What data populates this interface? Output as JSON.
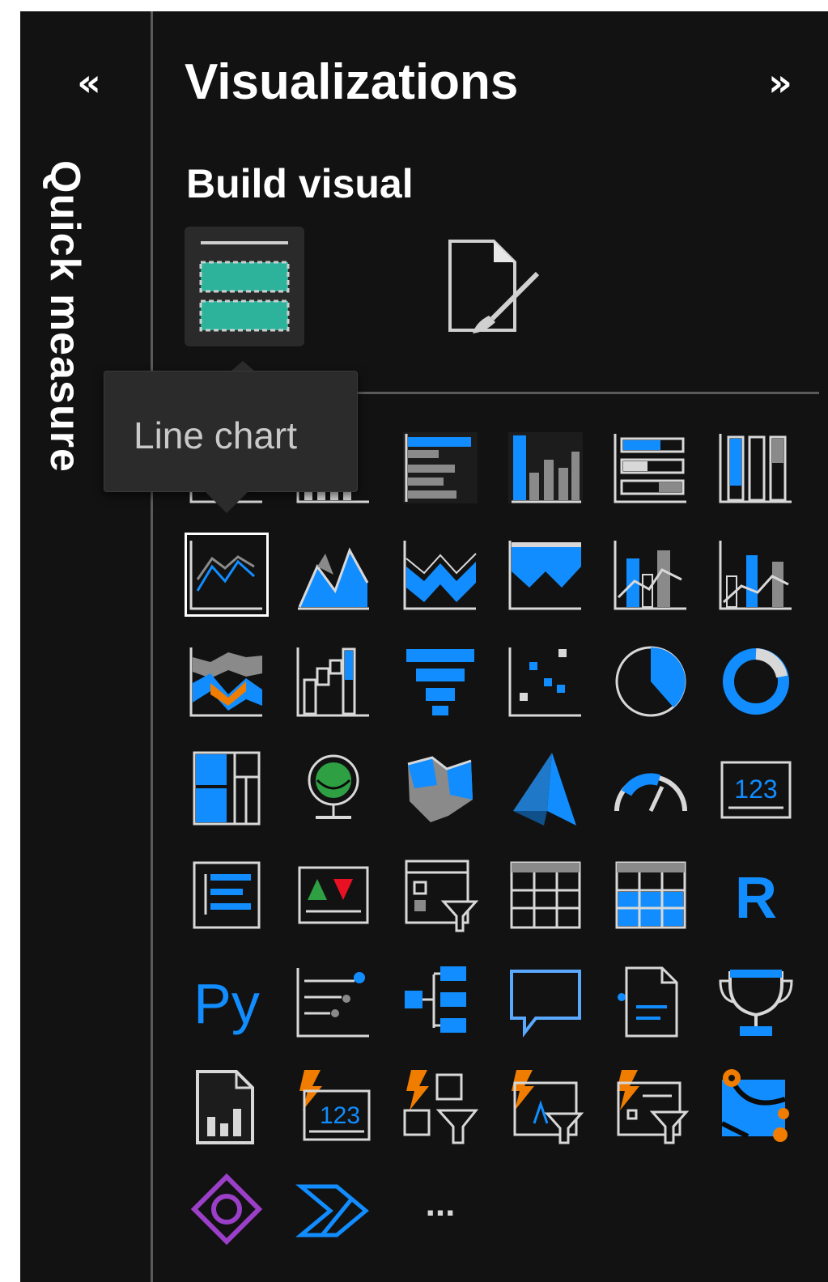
{
  "pane": {
    "title": "Visualizations",
    "collapse_glyph": "«",
    "expand_glyph": "»",
    "rail_label": "Quick measure",
    "build_label": "Build visual",
    "build_buttons": [
      {
        "name": "fields-icon"
      },
      {
        "name": "format-visual-icon"
      }
    ],
    "tooltip": "Line chart",
    "more_label": "...",
    "colors": {
      "background": "#121212",
      "blue": "#118dff",
      "teal": "#2db39b",
      "orange": "#f07d00",
      "purple": "#9b3fc8",
      "green": "#2ea043",
      "red": "#e81123"
    }
  },
  "visuals": [
    {
      "name": "stacked-bar-chart-icon"
    },
    {
      "name": "stacked-column-chart-icon"
    },
    {
      "name": "clustered-bar-chart-icon"
    },
    {
      "name": "clustered-column-chart-icon"
    },
    {
      "name": "100-stacked-bar-chart-icon"
    },
    {
      "name": "100-stacked-column-chart-icon"
    },
    {
      "name": "line-chart-icon"
    },
    {
      "name": "area-chart-icon"
    },
    {
      "name": "stacked-area-chart-icon"
    },
    {
      "name": "100-stacked-area-chart-icon"
    },
    {
      "name": "line-and-stacked-column-chart-icon"
    },
    {
      "name": "line-and-clustered-column-chart-icon"
    },
    {
      "name": "ribbon-chart-icon"
    },
    {
      "name": "waterfall-chart-icon"
    },
    {
      "name": "funnel-icon"
    },
    {
      "name": "scatter-chart-icon"
    },
    {
      "name": "pie-chart-icon"
    },
    {
      "name": "donut-chart-icon"
    },
    {
      "name": "treemap-icon"
    },
    {
      "name": "map-icon"
    },
    {
      "name": "filled-map-icon"
    },
    {
      "name": "azure-map-icon"
    },
    {
      "name": "gauge-icon"
    },
    {
      "name": "card-icon"
    },
    {
      "name": "multi-row-card-icon"
    },
    {
      "name": "kpi-icon"
    },
    {
      "name": "slicer-icon"
    },
    {
      "name": "table-icon"
    },
    {
      "name": "matrix-icon"
    },
    {
      "name": "r-script-visual-icon"
    },
    {
      "name": "python-visual-icon"
    },
    {
      "name": "key-influencers-icon"
    },
    {
      "name": "decomposition-tree-icon"
    },
    {
      "name": "qa-icon"
    },
    {
      "name": "smart-narrative-icon"
    },
    {
      "name": "metrics-icon"
    },
    {
      "name": "paginated-report-icon"
    },
    {
      "name": "card-new-icon"
    },
    {
      "name": "slicer-new-icon"
    },
    {
      "name": "button-slicer-icon"
    },
    {
      "name": "list-slicer-icon"
    },
    {
      "name": "arcgis-map-icon"
    },
    {
      "name": "power-apps-icon"
    },
    {
      "name": "power-automate-icon"
    },
    {
      "name": "more-visuals-icon"
    }
  ]
}
